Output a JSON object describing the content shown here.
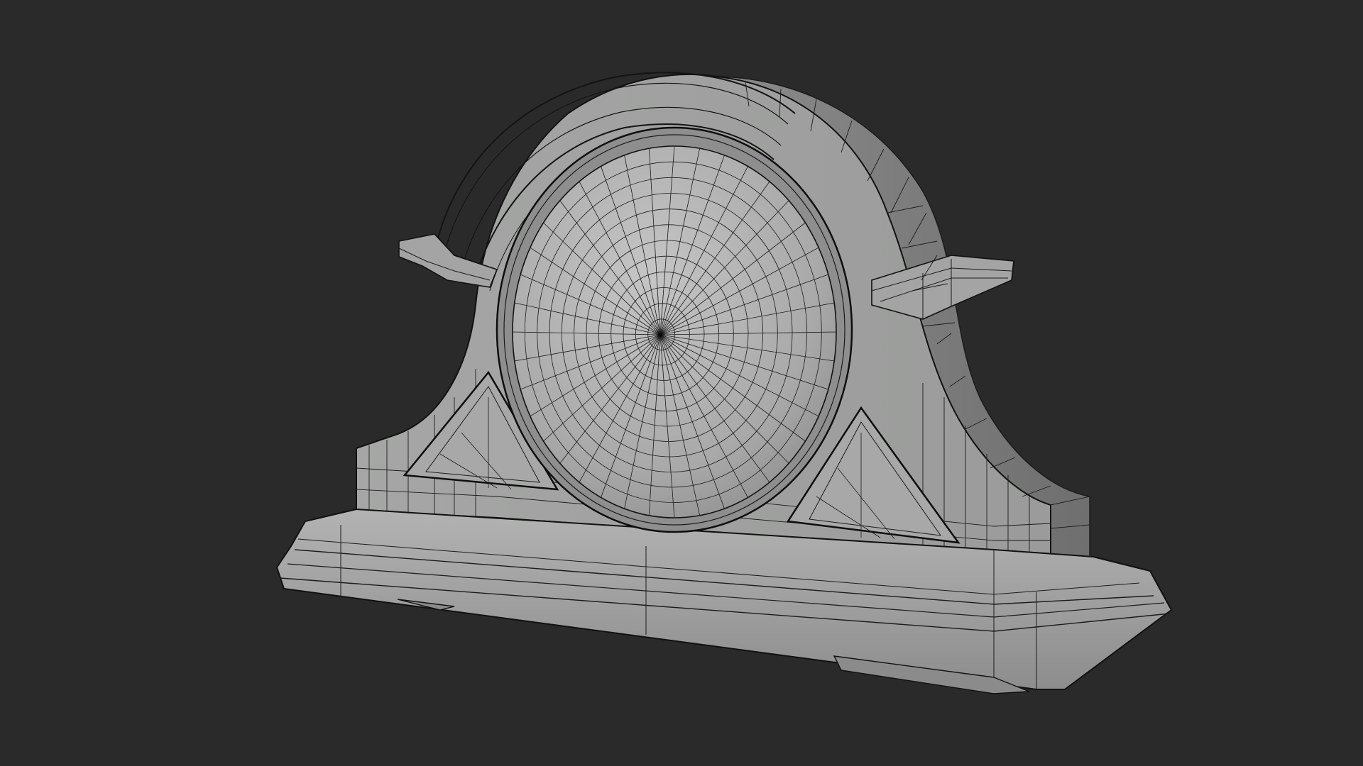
{
  "viewport": {
    "background": "#2a2a2a",
    "shading": "solid-gray-wireframe-overlay"
  },
  "model": {
    "subject": "mantel-clock",
    "surface_color": "#9c9d9c",
    "wire_color": "#1b1b1b",
    "edge_color": "#0d0d0d"
  }
}
